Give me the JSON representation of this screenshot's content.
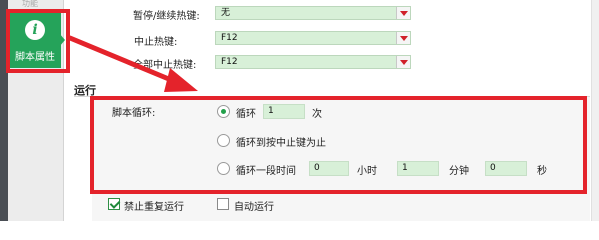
{
  "nav": {
    "faded_item_label": "功能",
    "active_item_label": "脚本属性",
    "active_item_icon": "info-icon"
  },
  "hotkeys": {
    "pause_label": "暂停/继续热键:",
    "pause_value": "无",
    "stop_label": "中止热键:",
    "stop_value": "F12",
    "stop_all_label": "全部中止热键:",
    "stop_all_value": "F12"
  },
  "run": {
    "section_title": "运行",
    "loop_label": "脚本循环:",
    "option_loop_label": "循环",
    "option_loop_count": "1",
    "option_loop_unit": "次",
    "option_until_stop_label": "循环到按中止键为止",
    "option_duration_label": "循环一段时间",
    "hours_value": "0",
    "hours_unit": "小时",
    "minutes_value": "1",
    "minutes_unit": "分钟",
    "seconds_value": "0",
    "seconds_unit": "秒",
    "selected_option": "loop-count"
  },
  "checks": {
    "no_repeat_label": "禁止重复运行",
    "no_repeat_checked": true,
    "auto_run_label": "自动运行",
    "auto_run_checked": false
  },
  "colors": {
    "nav_active": "#25a35a",
    "annotation_red": "#e4232b",
    "field_green": "#d8f0d8"
  }
}
